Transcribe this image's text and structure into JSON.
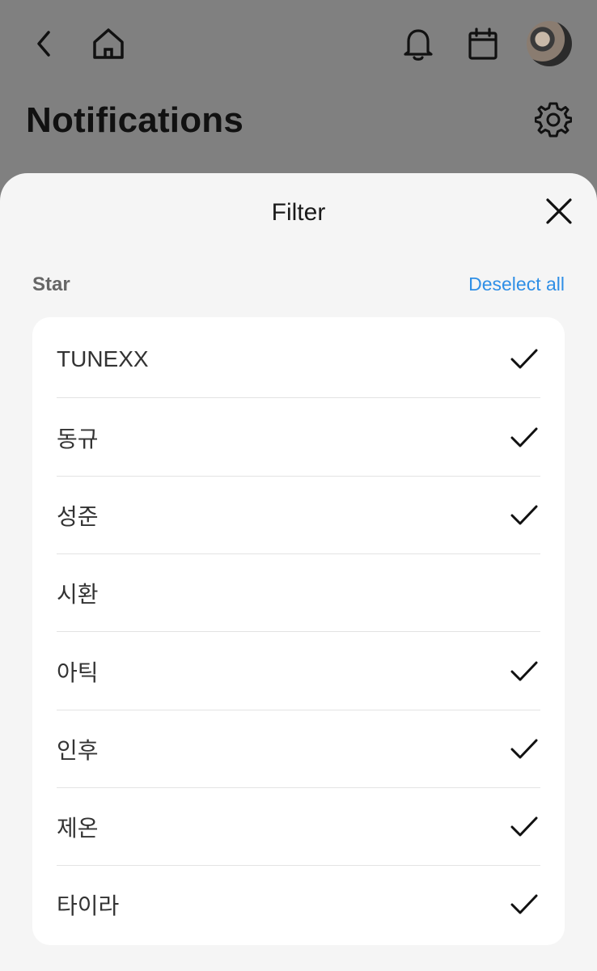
{
  "header": {
    "title": "Notifications",
    "icons": [
      "back-icon",
      "home-icon",
      "bell-icon",
      "calendar-icon",
      "avatar",
      "gear-icon"
    ]
  },
  "filter": {
    "title": "Filter",
    "section_label": "Star",
    "deselect_all": "Deselect all",
    "accent_color": "#2f8fe6",
    "items": [
      {
        "label": "TUNEXX",
        "checked": true
      },
      {
        "label": "동규",
        "checked": true
      },
      {
        "label": "성준",
        "checked": true
      },
      {
        "label": "시환",
        "checked": false
      },
      {
        "label": "아틱",
        "checked": true
      },
      {
        "label": "인후",
        "checked": true
      },
      {
        "label": "제온",
        "checked": true
      },
      {
        "label": "타이라",
        "checked": true
      }
    ]
  }
}
